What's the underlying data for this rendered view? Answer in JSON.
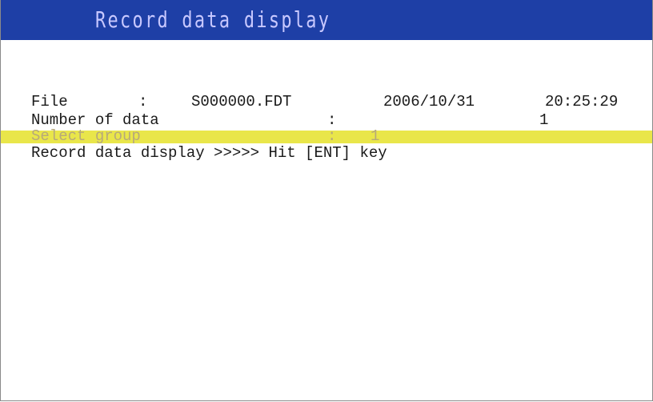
{
  "header": {
    "title": "Record data display"
  },
  "file_line": {
    "label": "File",
    "separator": ":",
    "filename": "S000000.FDT",
    "date": "2006/10/31",
    "time": "20:25:29"
  },
  "number_line": {
    "label": "Number of data",
    "separator": ":",
    "value": "1"
  },
  "group_line": {
    "label": "Select group",
    "separator": ":",
    "value": "1"
  },
  "action_line": {
    "text": "Record data display >>>>> Hit [ENT] key"
  },
  "colors": {
    "title_bar": "#1e3fa6",
    "title_text": "#c8c8ff",
    "highlight": "#e9e64a"
  }
}
